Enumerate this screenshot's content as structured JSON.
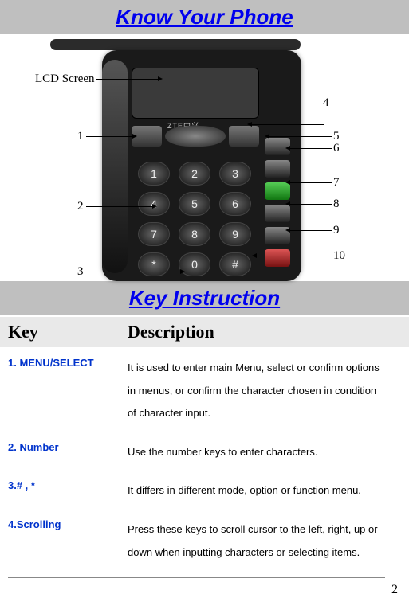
{
  "sections": {
    "know_your_phone": "Know Your Phone",
    "key_instruction": "Key Instruction"
  },
  "diagram": {
    "lcd_label": "LCD Screen",
    "brand": "ZTE中兴",
    "callouts": {
      "c1": "1",
      "c2": "2",
      "c3": "3",
      "c4": "4",
      "c5": "5",
      "c6": "6",
      "c7": "7",
      "c8": "8",
      "c9": "9",
      "c10": "10"
    },
    "keypad": [
      "1",
      "2",
      "3",
      "4",
      "5",
      "6",
      "7",
      "8",
      "9",
      "*",
      "0",
      "#"
    ]
  },
  "table": {
    "header_key": "Key",
    "header_desc": "Description",
    "rows": [
      {
        "key": "1. MENU/SELECT",
        "desc": "It is used to enter main Menu, select or confirm options in menus, or confirm the character chosen in condition of character input."
      },
      {
        "key": "2. Number",
        "desc": "Use the number keys to enter characters."
      },
      {
        "key": "3.# , *",
        "desc": "It differs in different mode, option or function menu."
      },
      {
        "key": "4.Scrolling",
        "desc": "Press these keys to scroll cursor to the left, right, up or down when inputting characters or selecting items."
      }
    ]
  },
  "page_number": "2"
}
